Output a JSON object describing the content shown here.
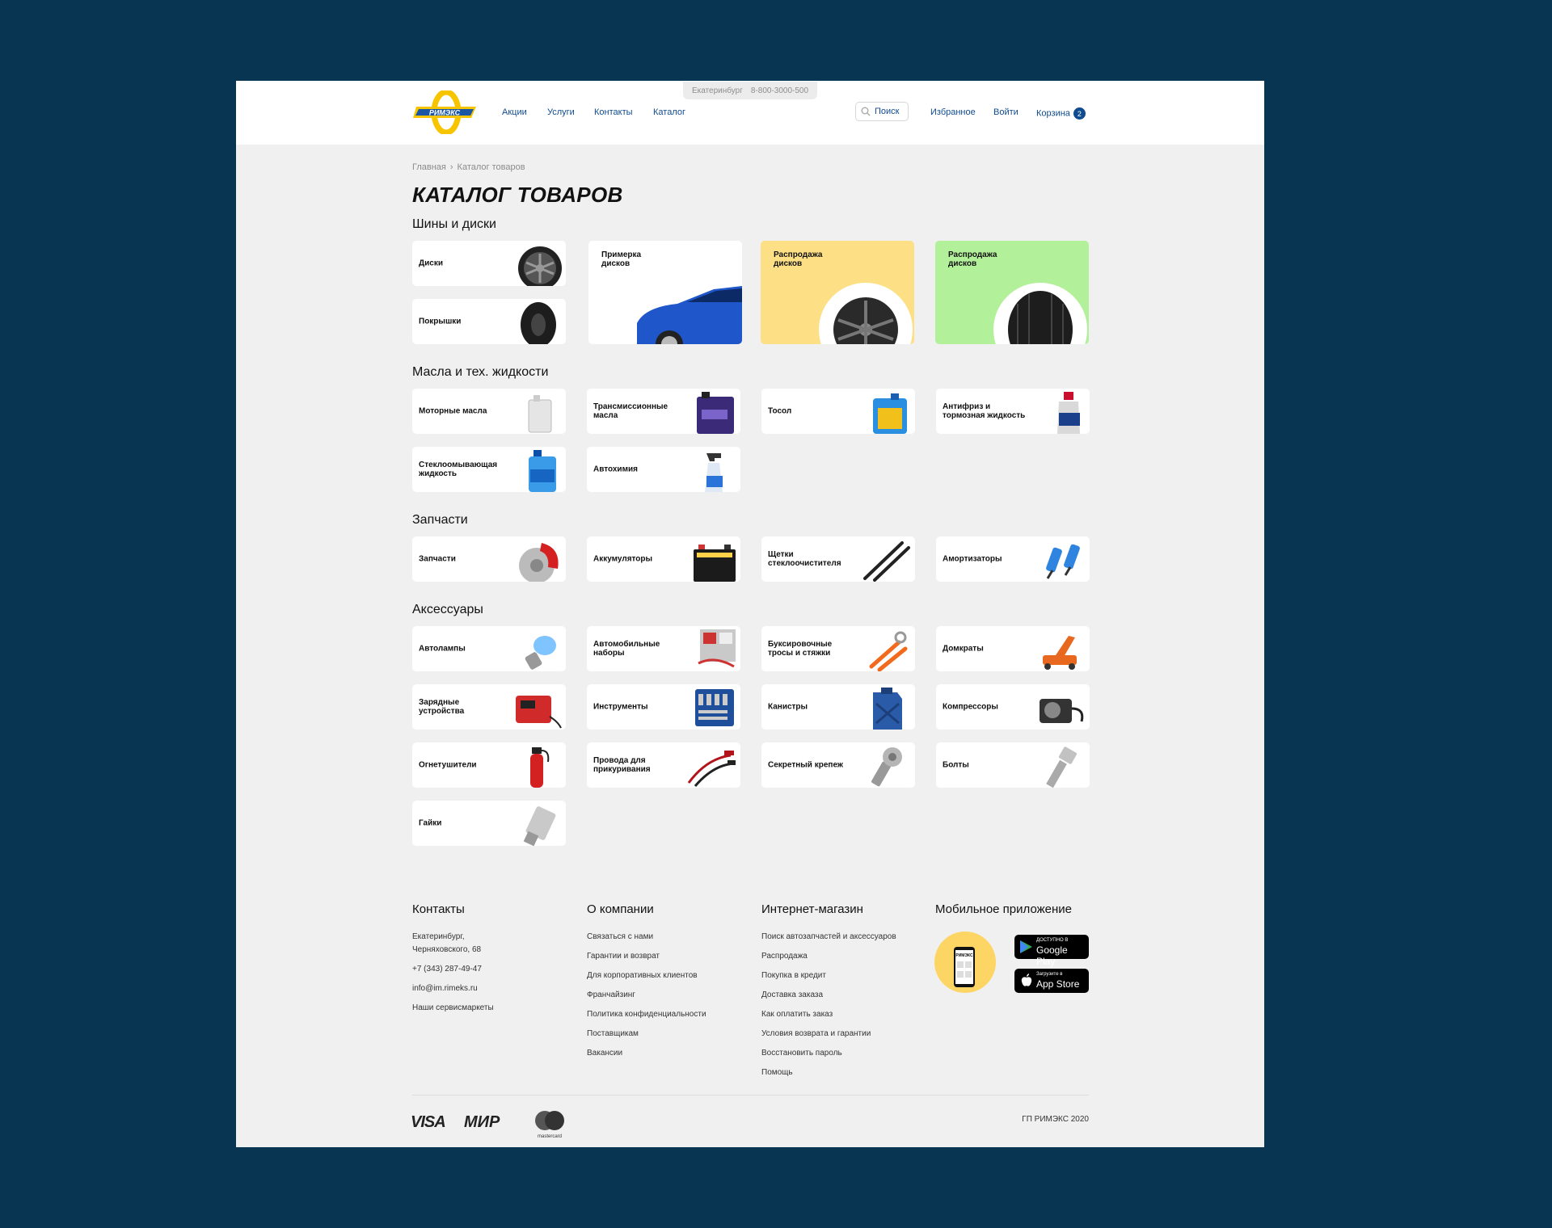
{
  "header": {
    "city": "Екатеринбург",
    "phone": "8-800-3000-500",
    "logo_text": "РИМЭКС",
    "nav": [
      "Акции",
      "Услуги",
      "Контакты",
      "Каталог"
    ],
    "search_label": "Поиск",
    "favorites": "Избранное",
    "login": "Войти",
    "cart": "Корзина",
    "cart_count": "2"
  },
  "breadcrumb": [
    "Главная",
    "Каталог товаров"
  ],
  "page_title": "КАТАЛОГ ТОВАРОВ",
  "sections": {
    "tires": {
      "title": "Шины и диски",
      "items": [
        "Диски",
        "Покрышки"
      ],
      "promo": [
        "Примерка дисков",
        "Распродажа дисков",
        "Распродажа дисков"
      ]
    },
    "oils": {
      "title": "Масла и тех. жидкости",
      "items": [
        "Моторные масла",
        "Трансмиссионные масла",
        "Тосол",
        "Антифриз и тормозная жидкость",
        "Стеклоомывающая жидкость",
        "Автохимия"
      ]
    },
    "parts": {
      "title": "Запчасти",
      "items": [
        "Запчасти",
        "Аккумуляторы",
        "Щетки стеклоочистителя",
        "Амортизаторы"
      ]
    },
    "accessories": {
      "title": "Аксессуары",
      "items": [
        "Автолампы",
        "Автомобильные наборы",
        "Буксировочные тросы и стяжки",
        "Домкраты",
        "Зарядные устройства",
        "Инструменты",
        "Канистры",
        "Компрессоры",
        "Огнетушители",
        "Провода для прикуривания",
        "Секретный крепеж",
        "Болты",
        "Гайки"
      ]
    }
  },
  "footer": {
    "contacts": {
      "title": "Контакты",
      "address1": "Екатеринбург,",
      "address2": "Черняховского, 68",
      "phone": "+7 (343) 287-49-47",
      "email": "info@im.rimeks.ru",
      "service": "Наши сервисмаркеты"
    },
    "company": {
      "title": "О компании",
      "links": [
        "Связаться с нами",
        "Гарантии и возврат",
        "Для корпоративных клиентов",
        "Франчайзинг",
        "Политика конфиденциальности",
        "Поставщикам",
        "Вакансии"
      ]
    },
    "shop": {
      "title": "Интернет-магазин",
      "links": [
        "Поиск автозапчастей и аксессуаров",
        "Распродажа",
        "Покупка в кредит",
        "Доставка заказа",
        "Как оплатить заказ",
        "Условия возврата и гарантии",
        "Восстановить пароль",
        "Помощь"
      ]
    },
    "app": {
      "title": "Мобильное приложение",
      "phone_logo": "РИМЭКС",
      "google_small": "ДОСТУПНО В",
      "google_big": "Google Play",
      "apple_small": "Загрузите в",
      "apple_big": "App Store"
    },
    "payments": [
      "VISA",
      "МИР",
      "mastercard"
    ],
    "copyright": "ГП РИМЭКС 2020"
  },
  "colors": {
    "background": "#073552",
    "brand_blue": "#0f4b8f",
    "brand_yellow": "#f7c400",
    "promo_yellow": "#fde085",
    "promo_green": "#b3f09a"
  }
}
